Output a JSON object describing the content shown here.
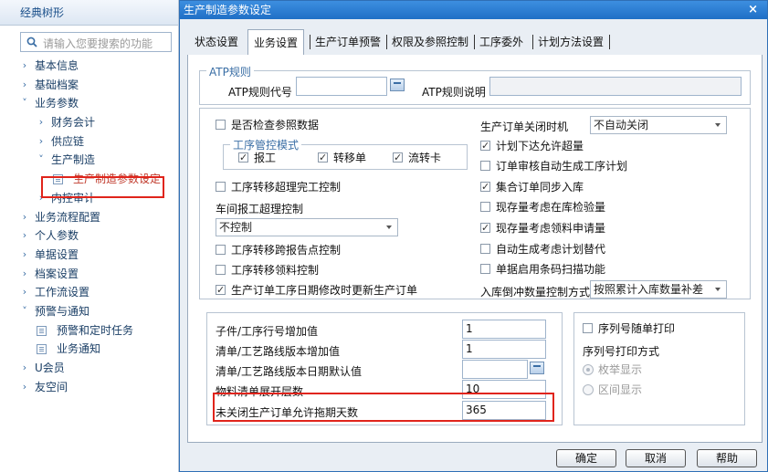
{
  "left_panel": {
    "header": "经典树形",
    "search_placeholder": "请输入您要搜索的功能",
    "tree": [
      {
        "label": "基本信息"
      },
      {
        "label": "基础档案"
      },
      {
        "label": "业务参数"
      },
      {
        "label": "财务会计"
      },
      {
        "label": "供应链"
      },
      {
        "label": "生产制造"
      },
      {
        "label": "生产制造参数设定"
      },
      {
        "label": "内控审计"
      },
      {
        "label": "业务流程配置"
      },
      {
        "label": "个人参数"
      },
      {
        "label": "单据设置"
      },
      {
        "label": "档案设置"
      },
      {
        "label": "工作流设置"
      },
      {
        "label": "预警与通知"
      },
      {
        "label": "预警和定时任务"
      },
      {
        "label": "业务通知"
      },
      {
        "label": "U会员"
      },
      {
        "label": "友空间"
      }
    ]
  },
  "dialog": {
    "title": "生产制造参数设定",
    "close": "×",
    "tabs": [
      "状态设置",
      "业务设置",
      "生产订单预警",
      "权限及参照控制",
      "工序委外",
      "计划方法设置"
    ],
    "atp": {
      "legend": "ATP规则",
      "code_label": "ATP规则代号",
      "code_value": "",
      "desc_label": "ATP规则说明",
      "desc_value": ""
    },
    "settings": {
      "check_ref": "是否检查参照数据",
      "process_mode_legend": "工序管控模式",
      "report": "报工",
      "transfer": "转移单",
      "flow_card": "流转卡",
      "transfer_overdone": "工序转移超理完工控制",
      "shop_report_label": "车间报工超理控制",
      "shop_report_value": "不控制",
      "cross_report": "工序转移跨报告点控制",
      "transfer_pick": "工序转移领料控制",
      "update_date": "生产订单工序日期修改时更新生产订单",
      "close_time_label": "生产订单关闭时机",
      "close_time_value": "不自动关闭",
      "plan_over": "计划下达允许超量",
      "order_audit": "订单审核自动生成工序计划",
      "combined_sync": "集合订单同步入库",
      "stock_check": "现存量考虑在库检验量",
      "stock_pick": "现存量考虑领料申请量",
      "auto_substitute": "自动生成考虑计划替代",
      "barcode": "单据启用条码扫描功能",
      "backflush_label": "入库倒冲数量控制方式",
      "backflush_value": "按照累计入库数量补差"
    },
    "numbers": {
      "sub_line_inc_label": "子件/工序行号增加值",
      "sub_line_inc_value": "1",
      "bom_version_inc_label": "清单/工艺路线版本增加值",
      "bom_version_inc_value": "1",
      "bom_date_default_label": "清单/工艺路线版本日期默认值",
      "bom_date_default_value": "",
      "bom_expand_label": "物料清单展开层数",
      "bom_expand_value": "10",
      "delay_days_label": "未关闭生产订单允许拖期天数",
      "delay_days_value": "365"
    },
    "serial": {
      "print_with": "序列号随单打印",
      "print_mode_label": "序列号打印方式",
      "enum": "枚举显示",
      "interval": "区间显示"
    },
    "buttons": {
      "ok": "确定",
      "cancel": "取消",
      "help": "帮助"
    }
  }
}
